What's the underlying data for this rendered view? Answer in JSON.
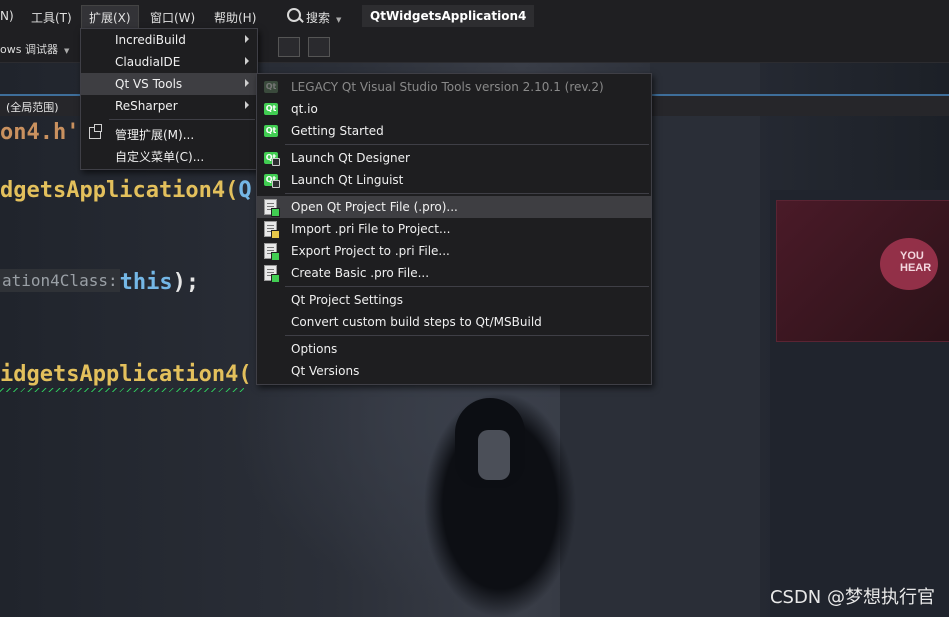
{
  "menubar": {
    "items": [
      "N)",
      "工具(T)",
      "扩展(X)",
      "窗口(W)",
      "帮助(H)"
    ],
    "search_label": "搜索",
    "project_title": "QtWidgetsApplication4"
  },
  "toolbar": {
    "debugger_label": "ows 调试器"
  },
  "scope": {
    "label": "(全局范围)"
  },
  "code": {
    "file_tab": "on4.h'",
    "line1": "dgetsApplication4(",
    "line1_q": "Q",
    "line2_hint": "ation4Class:",
    "line2_kw": "this",
    "line2_punct": ");",
    "line3": "idgetsApplication4("
  },
  "extensions_menu": {
    "items": [
      {
        "label": "IncrediBuild",
        "submenu": true
      },
      {
        "label": "ClaudiaIDE",
        "submenu": true
      },
      {
        "label": "Qt VS Tools",
        "submenu": true,
        "highlighted": true
      },
      {
        "label": "ReSharper",
        "submenu": true
      },
      {
        "label": "管理扩展(M)...",
        "icon": "manage-extensions-icon"
      },
      {
        "label": "自定义菜单(C)..."
      }
    ]
  },
  "qt_menu": {
    "items": [
      {
        "label": "LEGACY Qt Visual Studio Tools version 2.10.1 (rev.2)",
        "disabled": true,
        "icon": "qt-logo-icon"
      },
      {
        "label": "qt.io",
        "icon": "qt-logo-icon"
      },
      {
        "label": "Getting Started",
        "icon": "qt-logo-icon"
      },
      {
        "label": "Launch Qt Designer",
        "icon": "qt-designer-icon"
      },
      {
        "label": "Launch Qt Linguist",
        "icon": "qt-linguist-icon"
      },
      {
        "label": "Open Qt Project File (.pro)...",
        "icon": "open-pro-file-icon",
        "highlighted": true
      },
      {
        "label": "Import .pri File to Project...",
        "icon": "import-pri-icon"
      },
      {
        "label": "Export Project to .pri File...",
        "icon": "export-pri-icon"
      },
      {
        "label": "Create Basic .pro File...",
        "icon": "create-pro-icon"
      },
      {
        "label": "Qt Project Settings"
      },
      {
        "label": "Convert custom build steps to Qt/MSBuild"
      },
      {
        "label": "Options"
      },
      {
        "label": "Qt Versions"
      }
    ]
  },
  "background": {
    "sign_text_1": "YOU",
    "sign_text_2": "HEAR"
  },
  "watermark": "CSDN @梦想执行官",
  "colors": {
    "qt_green": "#41cd52",
    "menu_bg": "#1e1e20",
    "highlight": "#3e3e42"
  }
}
